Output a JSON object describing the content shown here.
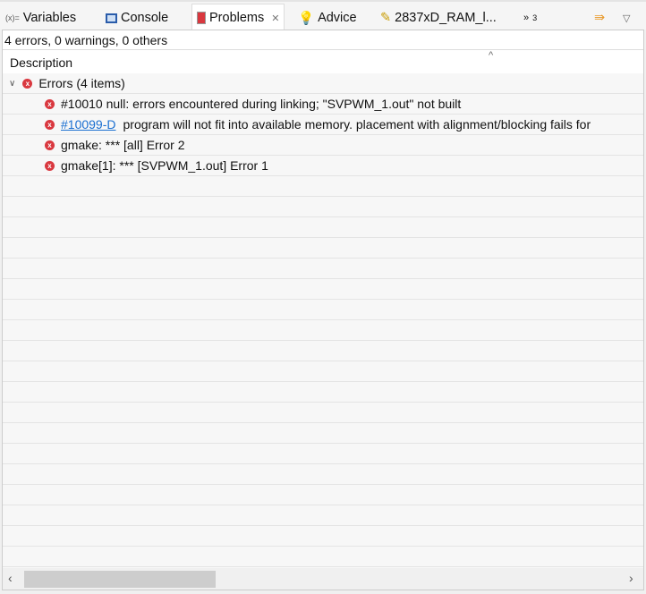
{
  "tabs": [
    {
      "label": "Variables",
      "icon": "variables-icon"
    },
    {
      "label": "Console",
      "icon": "console-icon"
    },
    {
      "label": "Problems",
      "icon": "problems-icon",
      "active": true
    },
    {
      "label": "Advice",
      "icon": "lightbulb-icon"
    },
    {
      "label": "2837xD_RAM_l...",
      "icon": "linker-file-icon"
    }
  ],
  "overflow_count": "3",
  "summary": "4 errors, 0 warnings, 0 others",
  "column": "Description",
  "group": {
    "label": "Errors (4 items)"
  },
  "errors": [
    {
      "link": "",
      "text": "#10010 null: errors encountered during linking; \"SVPWM_1.out\" not built"
    },
    {
      "link": "#10099-D",
      "text": "program will not fit into available memory.  placement with alignment/blocking fails for"
    },
    {
      "link": "",
      "text": "gmake: *** [all] Error 2"
    },
    {
      "link": "",
      "text": "gmake[1]: *** [SVPWM_1.out] Error 1"
    }
  ],
  "variables_prefix": "(x)=",
  "colors": {
    "error": "#d9383f",
    "link": "#1a6fd1"
  }
}
